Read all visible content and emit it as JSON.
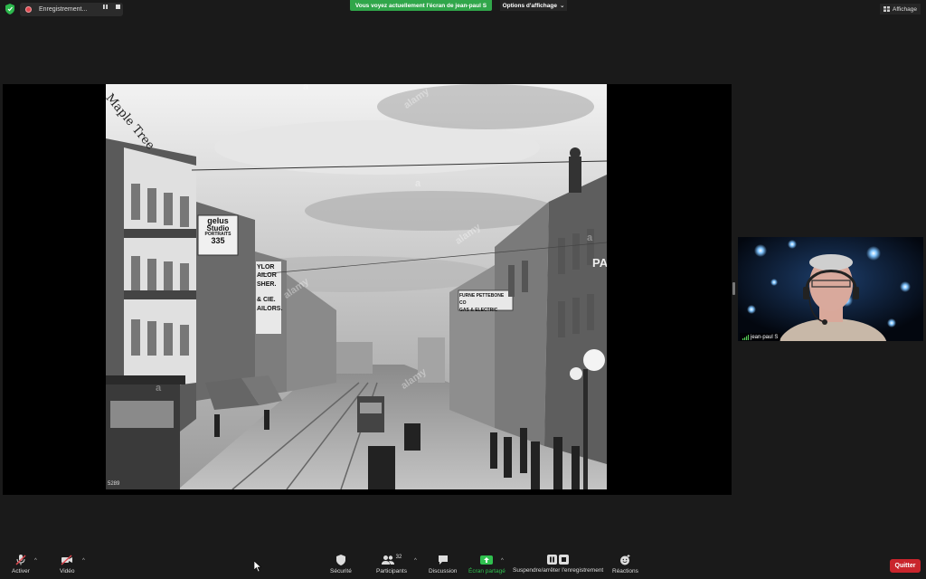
{
  "topbar": {
    "recording_label": "Enregistrement...",
    "share_banner": "Vous voyez actuellement l'écran de jean-paul S",
    "view_options": "Options d'affichage",
    "view_chevron": "⌄",
    "layout_button": "Affichage"
  },
  "shared_screen": {
    "photo_number": "5289",
    "watermark": "a",
    "watermark_word": "alamy",
    "signs": {
      "store_top": "Maple Tree",
      "studio_1": "gelus",
      "studio_2": "Studio",
      "studio_3": "PORTRAITS",
      "studio_4": "335",
      "tailor_1": "YLOR",
      "tailor_2": "AILOR",
      "tailor_3": "SHER.",
      "tailor_4": "& CIE.",
      "tailor_5": "AILORS.",
      "gas": "FURNE PETTEBONE CO",
      "gas_2": "GAS & ELECTRIC",
      "right_edge": "PA"
    }
  },
  "participant": {
    "name": "jean-paul S"
  },
  "toolbar": {
    "mute_label": "Activer",
    "video_label": "Vidéo",
    "security_label": "Sécurité",
    "participants_label": "Participants",
    "participants_count": "32",
    "chat_label": "Discussion",
    "share_label": "Écran partagé",
    "record_label": "Suspendre/arrêter l'enregistrement",
    "reactions_label": "Réactions",
    "quit_label": "Quitter",
    "caret": "^"
  },
  "colors": {
    "share_green": "#30a64a",
    "quit_red": "#c9252c",
    "mute_red": "#e0484f"
  }
}
